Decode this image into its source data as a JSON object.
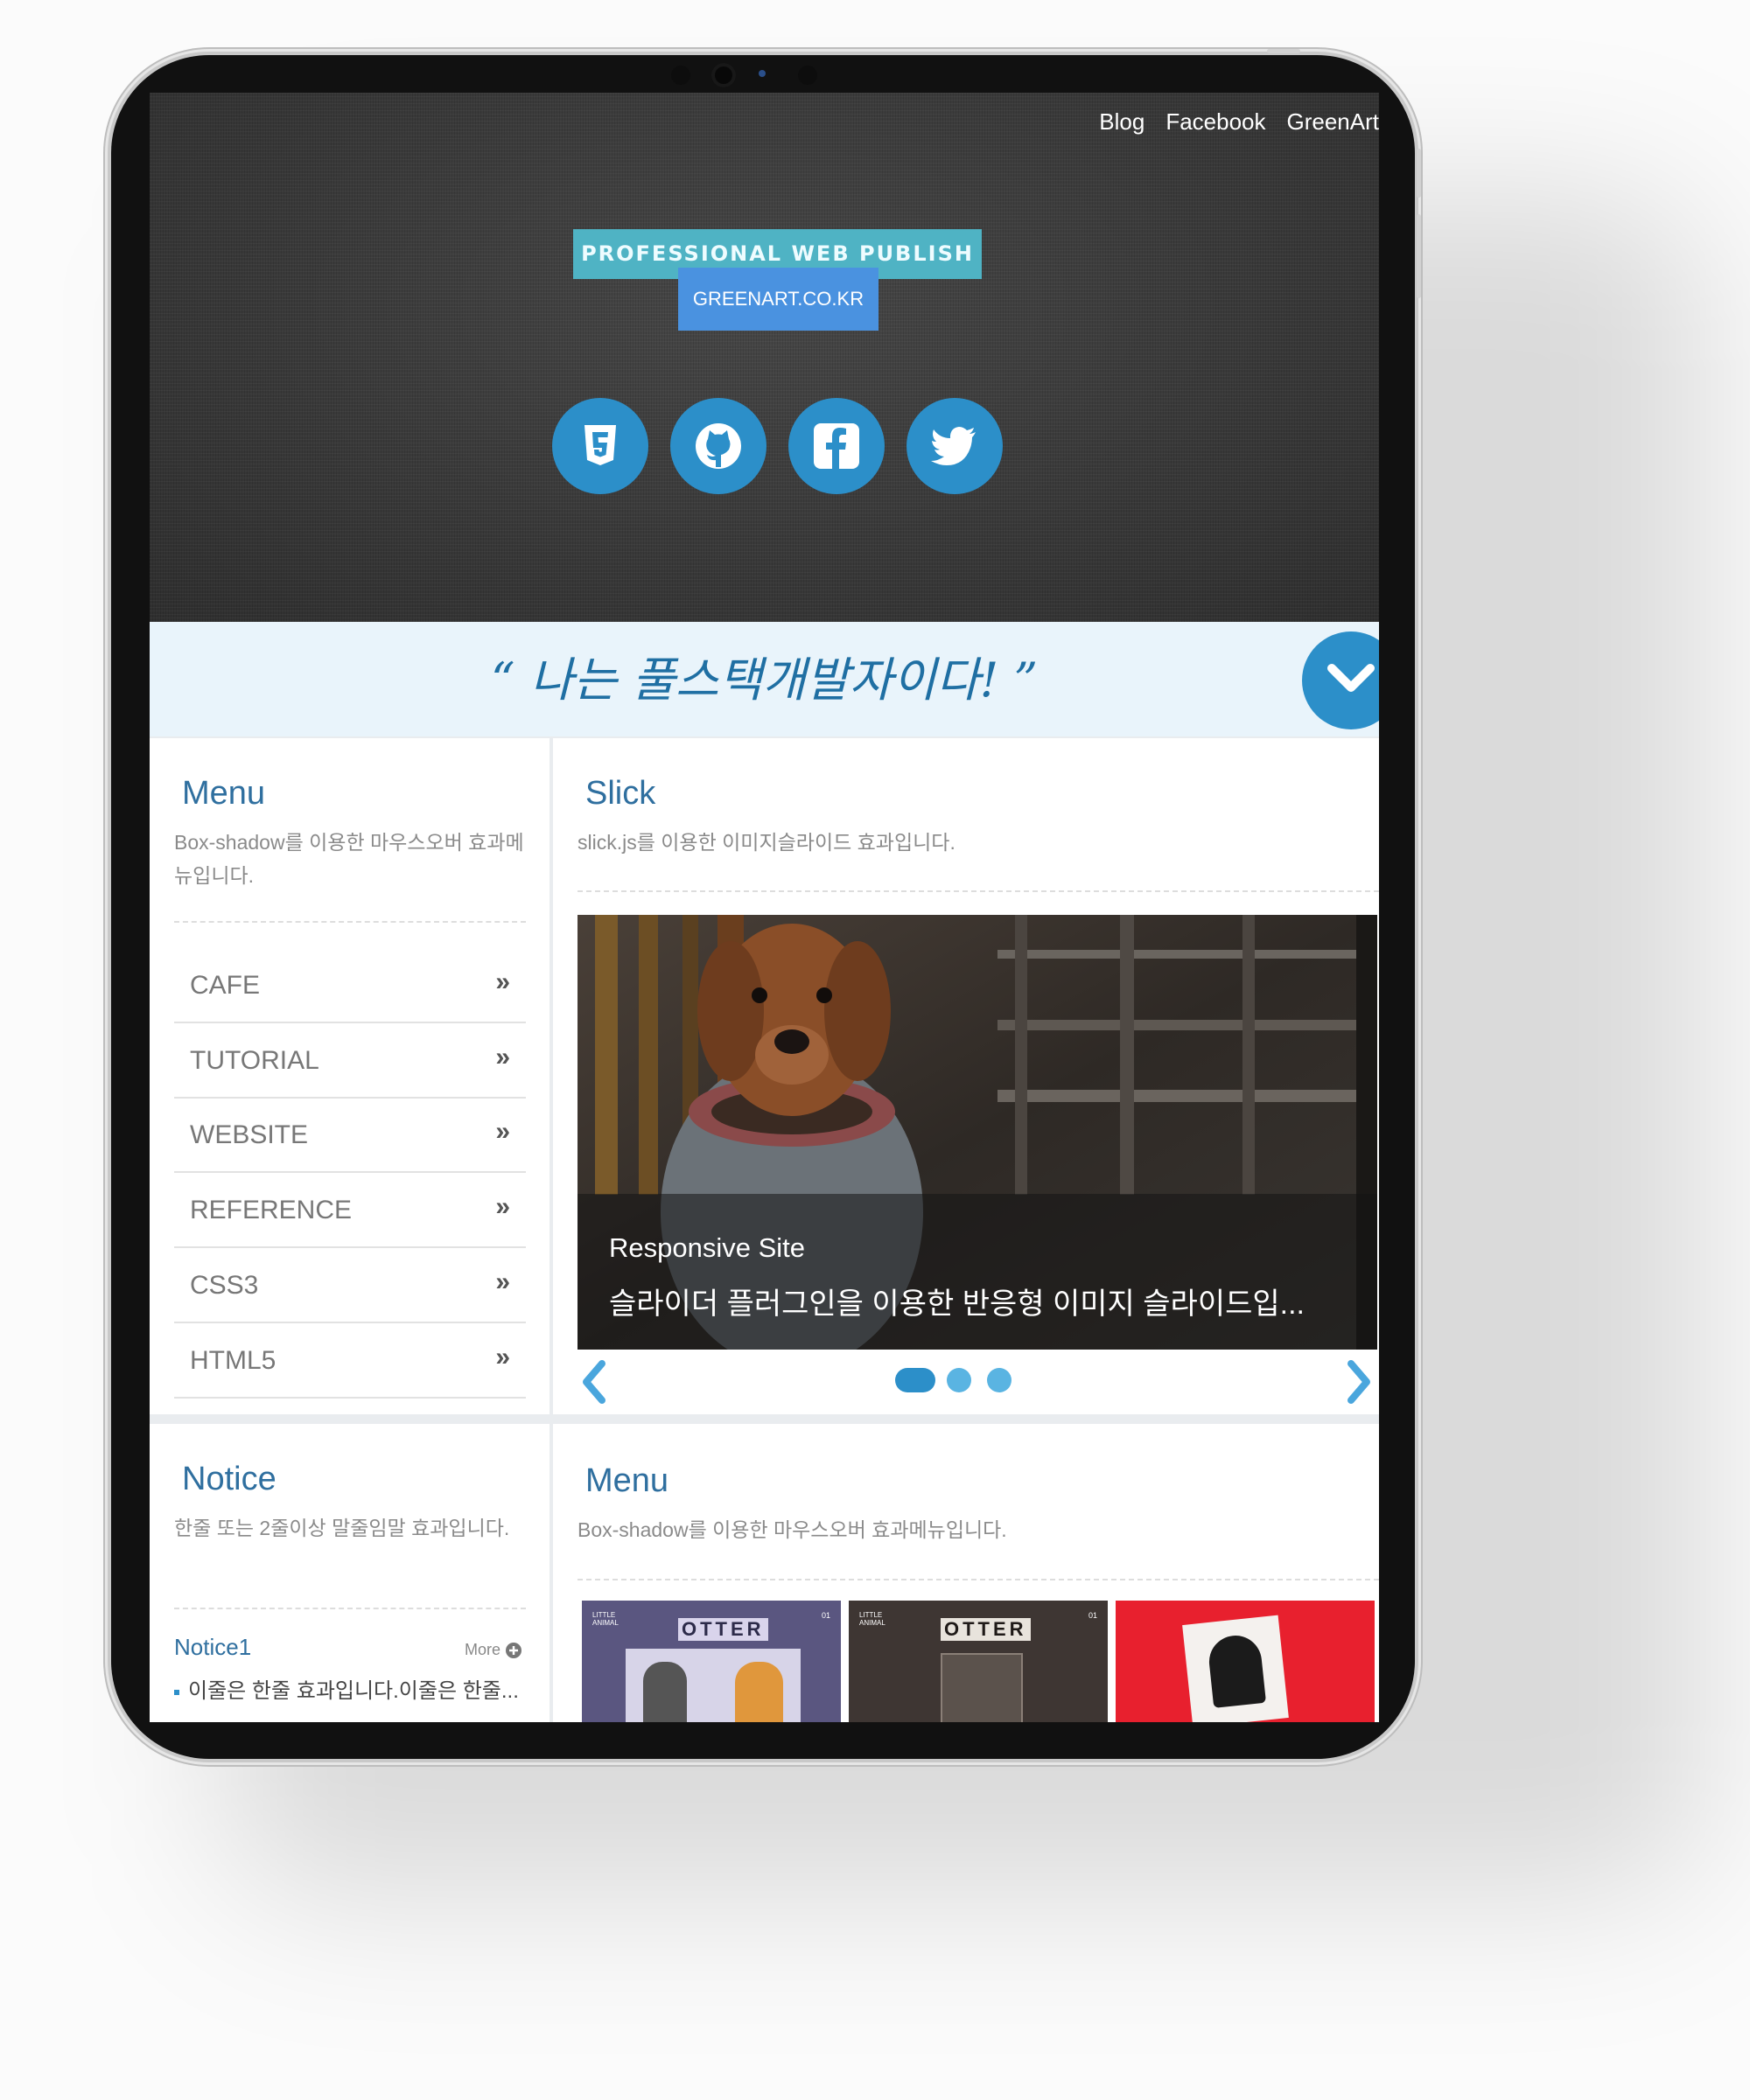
{
  "header": {
    "nav_links": [
      "Blog",
      "Facebook",
      "GreenArt"
    ],
    "badge_title": "PROFESSIONAL WEB PUBLISH",
    "badge_site": "GREENART.CO.KR",
    "social_icons": [
      "html5-icon",
      "github-icon",
      "facebook-icon",
      "twitter-icon"
    ]
  },
  "banner": {
    "slogan": "“ 나는 풀스택개발자이다! ”"
  },
  "menu_panel": {
    "title": "Menu",
    "description": "Box-shadow를 이용한 마우스오버 효과메뉴입니다.",
    "items": [
      "CAFE",
      "TUTORIAL",
      "WEBSITE",
      "REFERENCE",
      "CSS3",
      "HTML5"
    ],
    "chevron": "»"
  },
  "slick_panel": {
    "title": "Slick",
    "description": "slick.js를 이용한 이미지슬라이드 효과입니다.",
    "caption_title": "Responsive Site",
    "caption_text": "슬라이더 플러그인을 이용한 반응형 이미지 슬라이드입...",
    "slide_count": 3,
    "active_slide": 1
  },
  "notice_panel": {
    "title": "Notice",
    "description": "한줄 또는 2줄이상 말줄임말 효과입니다.",
    "tab": "Notice1",
    "more": "More",
    "items": [
      "이줄은 한줄 효과입니다.이줄은 한줄..."
    ]
  },
  "menu_panel_2": {
    "title": "Menu",
    "description": "Box-shadow를 이용한 마우스오버 효과메뉴입니다.",
    "thumbs": [
      {
        "brand": "LITTLE ANIMAL",
        "title": "OTTER",
        "num": "01"
      },
      {
        "brand": "LITTLE ANIMAL",
        "title": "OTTER",
        "num": "01"
      },
      {
        "brand": "",
        "title": "",
        "num": ""
      }
    ]
  },
  "colors": {
    "accent": "#2c8fc9",
    "badge_teal": "#4fb3c4",
    "badge_blue": "#4a92e0",
    "banner_bg": "#e9f4fb",
    "panel_title": "#2f6f9f"
  }
}
